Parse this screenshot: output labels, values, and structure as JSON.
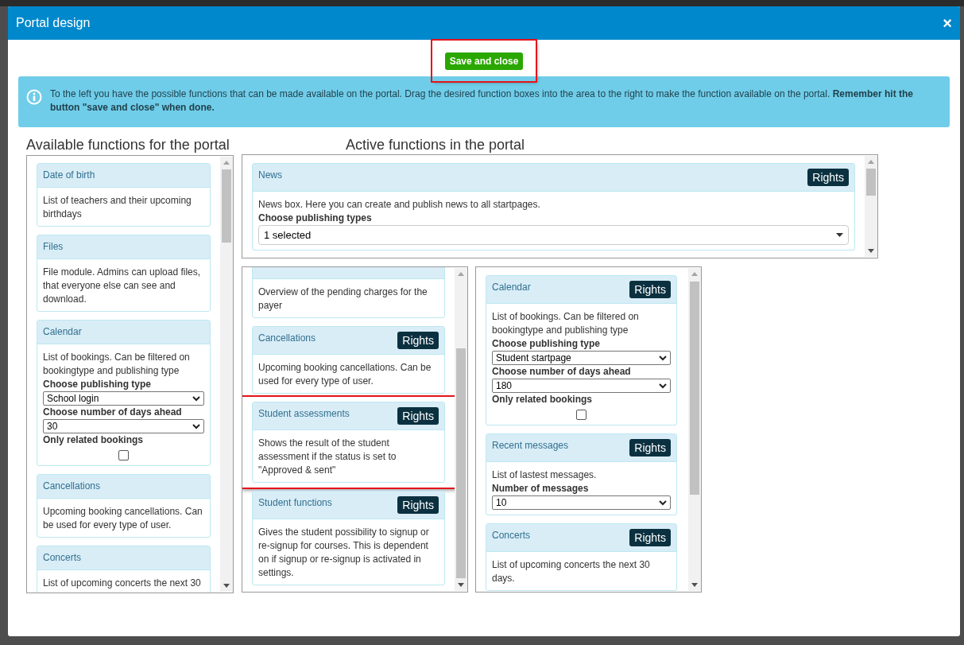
{
  "dialog": {
    "title": "Portal design",
    "close": "×",
    "save_button": {
      "label": "Save and close",
      "highlighted": true
    },
    "info": "To the left you have the possible functions that can be made available on the portal. Drag the desired function boxes into the area to the right to make the function available on the portal. **Remember hit the button \"save and close\" when done.**",
    "available_heading": "Available functions for the portal",
    "active_heading": "Active functions in the portal",
    "available": [
      {
        "title": "Date of birth",
        "description": "List of teachers and their upcoming birthdays"
      },
      {
        "title": "Files",
        "description": "File module. Admins can upload files, that everyone else can see and download."
      },
      {
        "title": "Calendar",
        "description": "List of bookings. Can be filtered on bookingtype and publishing type",
        "fields": [
          {
            "kind": "select",
            "label": "Choose publishing type",
            "value": "School login"
          },
          {
            "kind": "select",
            "label": "Choose number of days ahead",
            "value": "30"
          },
          {
            "kind": "checkbox",
            "label": "Only related bookings",
            "checked": false
          }
        ]
      },
      {
        "title": "Cancellations",
        "description": "Upcoming booking cancellations. Can be used for every type of user."
      },
      {
        "title": "Concerts",
        "description": "List of upcoming concerts the next 30"
      }
    ],
    "active_top": [
      {
        "title": "News",
        "rights": "Rights",
        "highlighted": false,
        "description": "News box. Here you can create and publish news to all startpages.",
        "fields": [
          {
            "kind": "multiselect",
            "label": "Choose publishing types",
            "value": "1 selected"
          }
        ]
      }
    ],
    "active_left": [
      {
        "highlighted": false,
        "description": "Overview of the pending charges for the payer"
      },
      {
        "title": "Cancellations",
        "rights": "Rights",
        "highlighted": false,
        "description": "Upcoming booking cancellations. Can be used for every type of user."
      },
      {
        "title": "Student assessments",
        "rights": "Rights",
        "highlighted": true,
        "description": "Shows the result of the student assessment if the status is set to \"Approved & sent\""
      },
      {
        "title": "Student functions",
        "rights": "Rights",
        "highlighted": false,
        "description": "Gives the student possibility to signup or re-signup for courses. This is dependent on if signup or re-signup is activated in settings."
      }
    ],
    "active_right": [
      {
        "title": "Calendar",
        "rights": "Rights",
        "highlighted": false,
        "description": "List of bookings. Can be filtered on bookingtype and publishing type",
        "fields": [
          {
            "kind": "select",
            "label": "Choose publishing type",
            "value": "Student startpage"
          },
          {
            "kind": "select",
            "label": "Choose number of days ahead",
            "value": "180"
          },
          {
            "kind": "checkbox",
            "label": "Only related bookings",
            "checked": false
          }
        ]
      },
      {
        "title": "Recent messages",
        "rights": "Rights",
        "highlighted": false,
        "description": "List of lastest messages.",
        "fields": [
          {
            "kind": "select",
            "label": "Number of messages",
            "value": "10"
          }
        ]
      },
      {
        "title": "Concerts",
        "rights": "Rights",
        "highlighted": false,
        "description": "List of upcoming concerts the next 30 days."
      }
    ]
  }
}
